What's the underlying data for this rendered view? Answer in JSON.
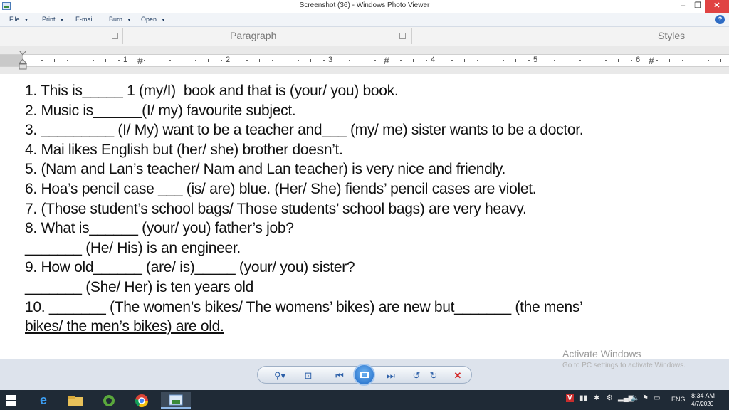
{
  "window": {
    "title": "Screenshot (36) - Windows Photo Viewer",
    "min": "–",
    "max": "❐",
    "close": "✕"
  },
  "menu": {
    "file": "File",
    "print": "Print",
    "email": "E-mail",
    "burn": "Burn",
    "open": "Open",
    "help": "?"
  },
  "ribbon": {
    "paragraph": "Paragraph",
    "styles": "Styles"
  },
  "ruler": {
    "numbers": [
      "1",
      "2",
      "3",
      "4",
      "5",
      "6"
    ]
  },
  "document": {
    "lines": [
      "1. This is_____ 1 (my/I)  book and that is (your/ you) book.",
      "2. Music is______(I/ my) favourite subject.",
      "3. _________ (I/ My) want to be a teacher and___ (my/ me) sister wants to be a doctor.",
      "4. Mai likes English but (her/ she) brother doesn’t.",
      "5. (Nam and Lan’s teacher/ Nam and Lan teacher) is very nice and friendly.",
      "6. Hoa’s pencil case ___ (is/ are) blue. (Her/ She) fiends’ pencil cases are violet.",
      "7. (Those student’s school bags/ Those students’ school bags) are very heavy.",
      "8. What is______ (your/ you) father’s job?",
      "_______ (He/ His) is an engineer.",
      "9. How old______ (are/ is)_____ (your/ you) sister?",
      "_______ (She/ Her) is ten years old",
      "10. _______ (The women’s bikes/ The womens’ bikes) are new but_______ (the mens’",
      "bikes/ the men’s bikes) are old."
    ]
  },
  "watermark": {
    "title": "Activate Windows",
    "subtitle": "Go to PC settings to activate Windows."
  },
  "controls": {
    "zoom": "⚲▾",
    "actual_size": "⊡",
    "previous": "⏮",
    "slideshow": "",
    "next": "⏭",
    "rotate_ccw": "↺",
    "rotate_cw": "↻",
    "delete": "✕"
  },
  "taskbar": {
    "language": "ENG",
    "time": "8:34 AM",
    "date": "4/7/2020"
  }
}
